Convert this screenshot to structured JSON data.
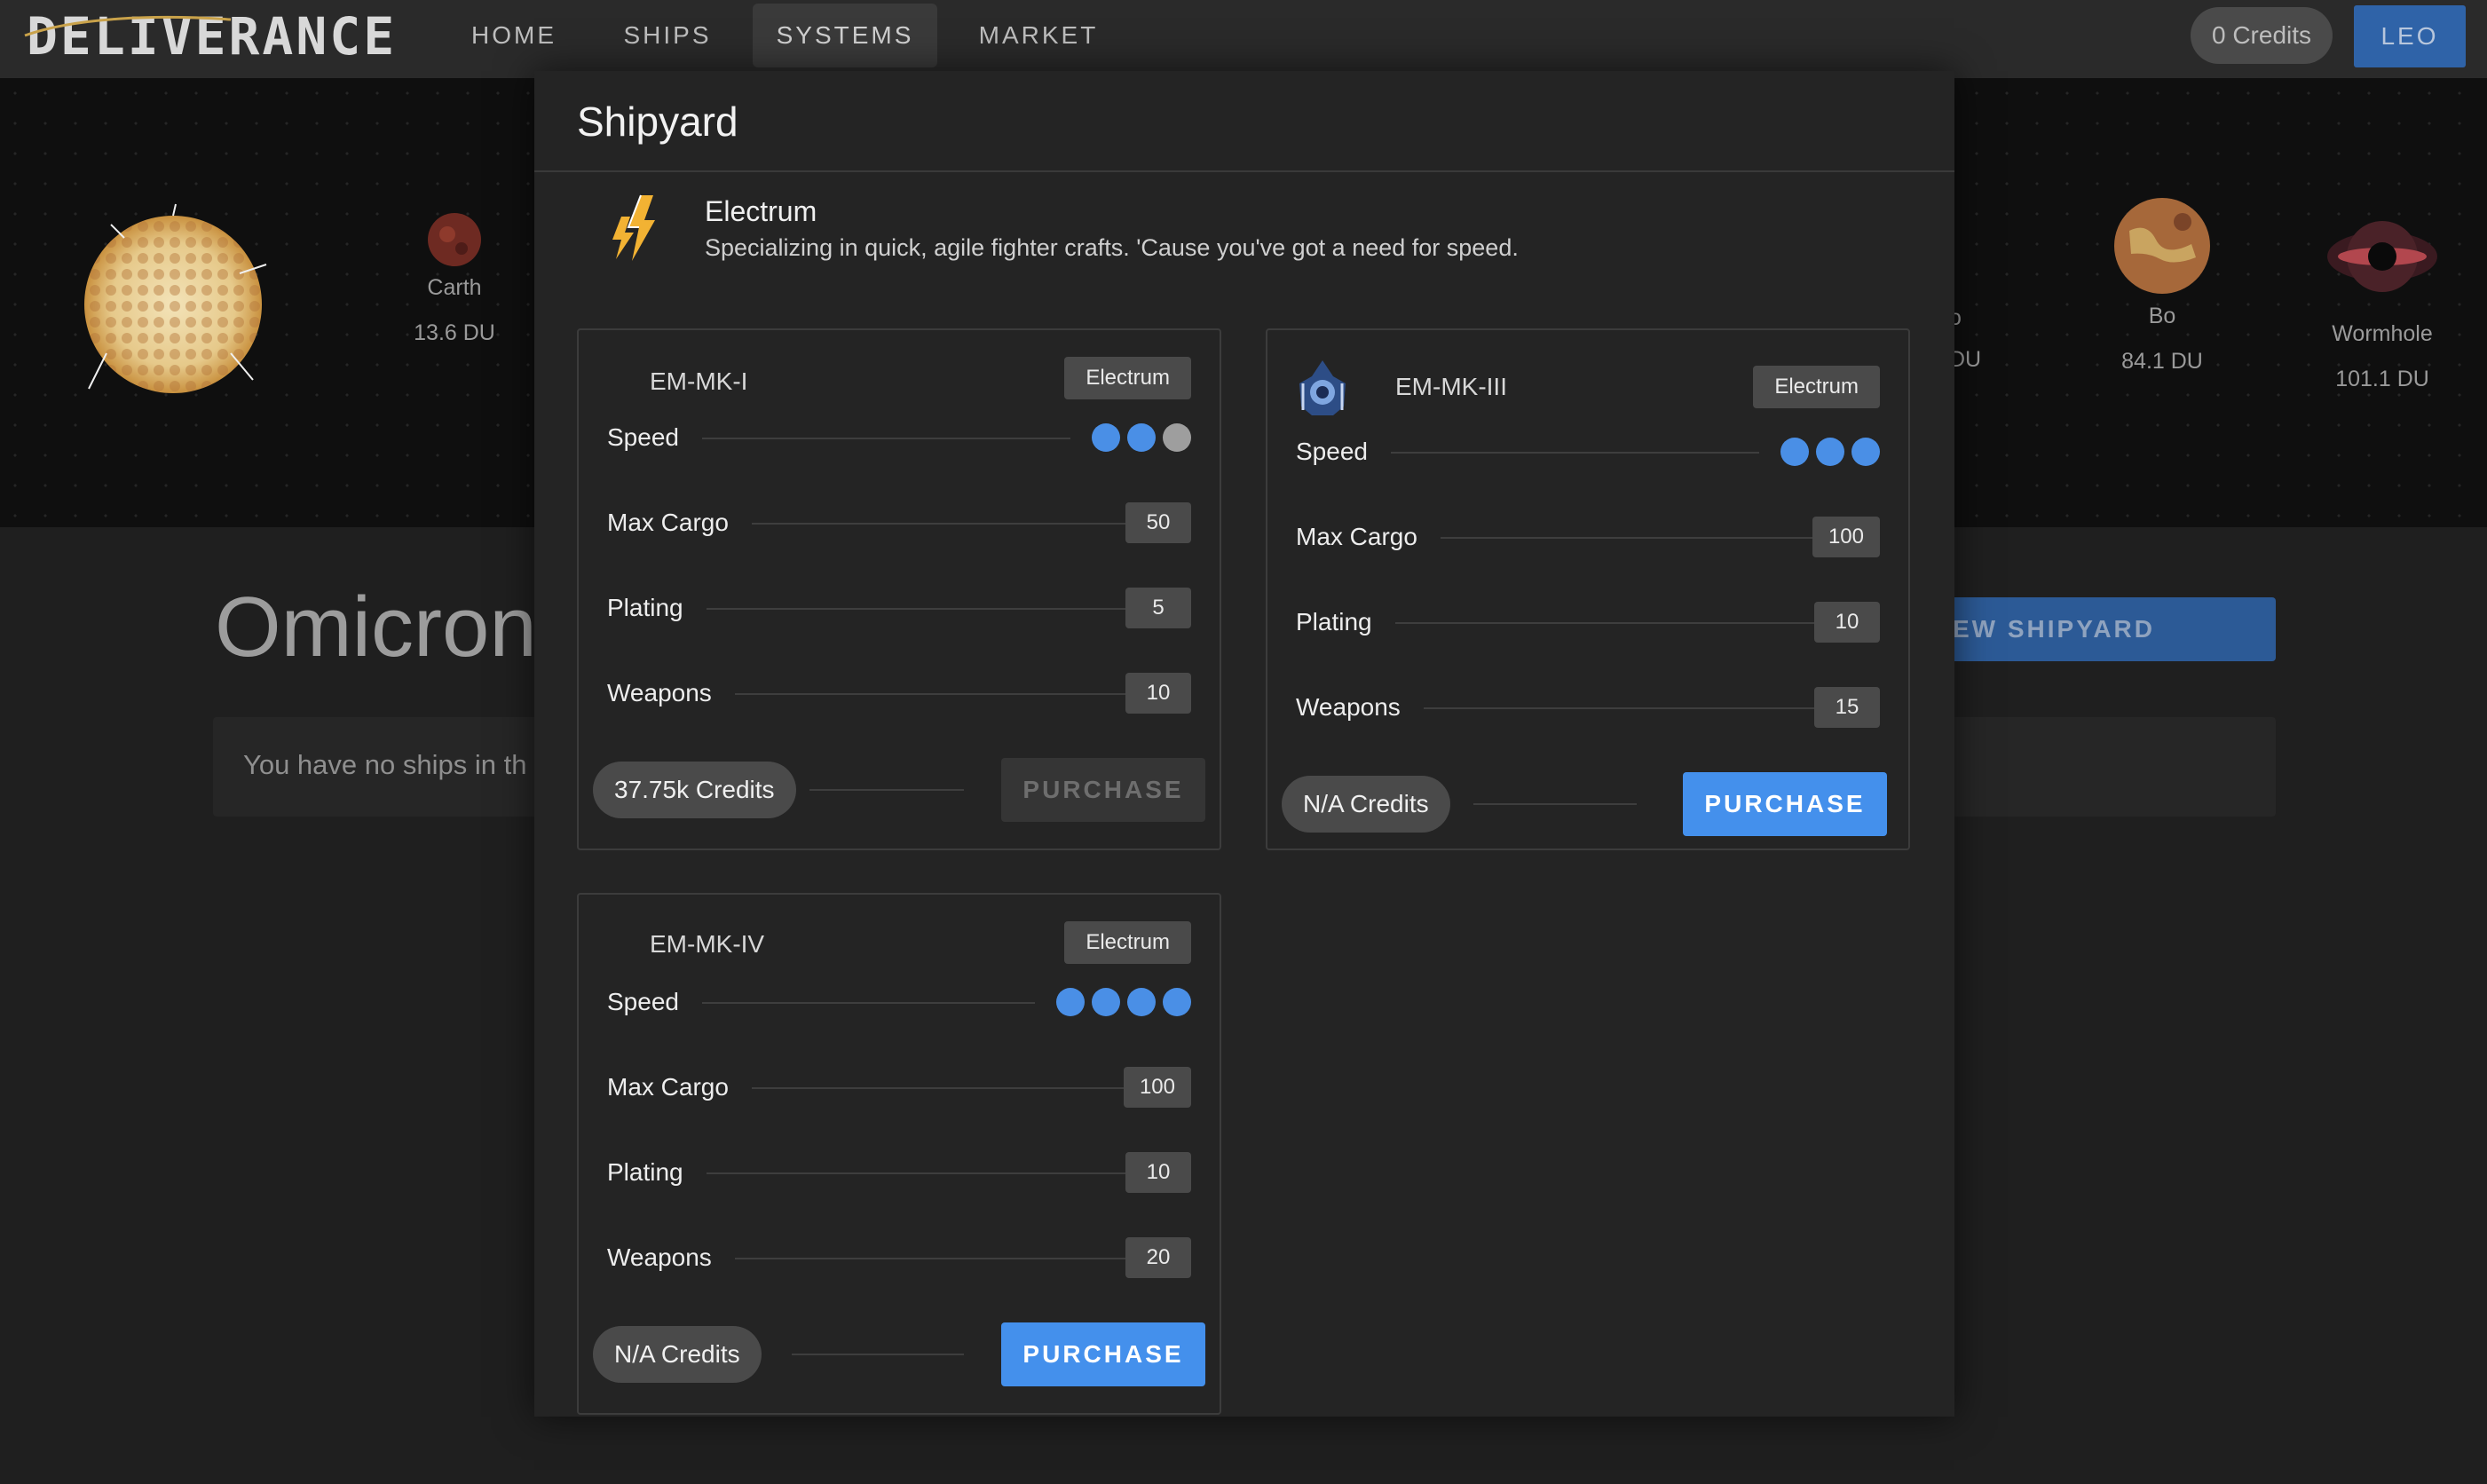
{
  "nav": {
    "logo": "DELIVERANCE",
    "items": [
      "HOME",
      "SHIPS",
      "SYSTEMS",
      "MARKET"
    ],
    "active": "SYSTEMS",
    "credits": "0 Credits",
    "user": "LEO"
  },
  "system_bodies": [
    {
      "name": "Carth",
      "distance": "13.6 DU"
    },
    {
      "name": "o",
      "distance": "DU"
    },
    {
      "name": "Bo",
      "distance": "84.1 DU"
    },
    {
      "name": "Wormhole",
      "distance": "101.1 DU"
    }
  ],
  "page": {
    "title": "Omicron",
    "view_shipyard_label": "EW SHIPYARD",
    "empty_message": "You have no ships in th"
  },
  "modal": {
    "title": "Shipyard",
    "manufacturer": {
      "name": "Electrum",
      "description": "Specializing in quick, agile fighter crafts. 'Cause you've got a need for speed.",
      "icon": "lightning-bolts-icon"
    },
    "ships": [
      {
        "name": "EM-MK-I",
        "maker": "Electrum",
        "icon": null,
        "speed": 2,
        "speed_max": 3,
        "stats": [
          {
            "label": "Max Cargo",
            "value": "50"
          },
          {
            "label": "Plating",
            "value": "5"
          },
          {
            "label": "Weapons",
            "value": "10"
          }
        ],
        "speed_label": "Speed",
        "price": "37.75k Credits",
        "purchase_label": "PURCHASE",
        "purchase_enabled": false
      },
      {
        "name": "EM-MK-III",
        "maker": "Electrum",
        "icon": "ship-icon",
        "speed": 3,
        "speed_max": 3,
        "stats": [
          {
            "label": "Max Cargo",
            "value": "100"
          },
          {
            "label": "Plating",
            "value": "10"
          },
          {
            "label": "Weapons",
            "value": "15"
          }
        ],
        "speed_label": "Speed",
        "price": "N/A Credits",
        "purchase_label": "PURCHASE",
        "purchase_enabled": true
      },
      {
        "name": "EM-MK-IV",
        "maker": "Electrum",
        "icon": null,
        "speed": 4,
        "speed_max": 4,
        "stats": [
          {
            "label": "Max Cargo",
            "value": "100"
          },
          {
            "label": "Plating",
            "value": "10"
          },
          {
            "label": "Weapons",
            "value": "20"
          }
        ],
        "speed_label": "Speed",
        "price": "N/A Credits",
        "purchase_label": "PURCHASE",
        "purchase_enabled": true
      }
    ]
  },
  "colors": {
    "accent": "#4490ec",
    "speed_dot_on": "#4a8fe6",
    "speed_dot_off": "#9e9e9e"
  }
}
